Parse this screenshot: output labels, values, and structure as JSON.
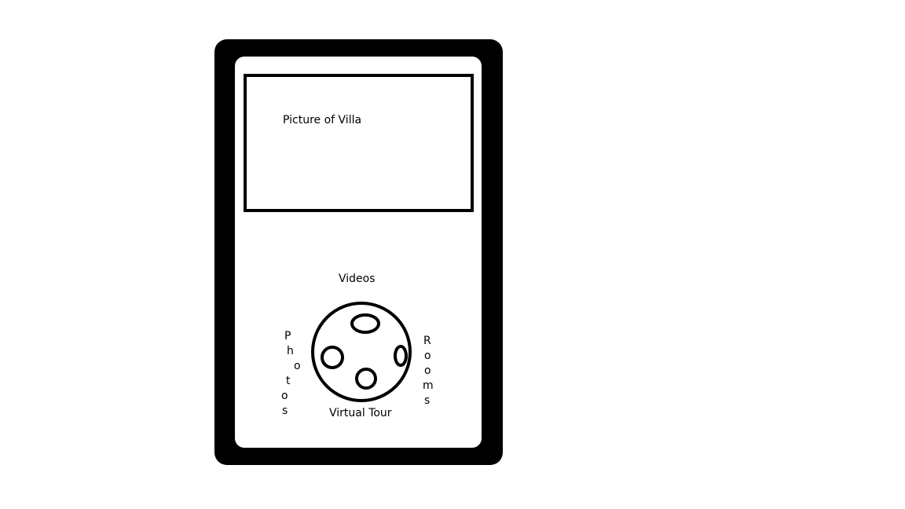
{
  "device": {
    "picture_label": "Picture of Villa",
    "menu": {
      "top_label": "Videos",
      "bottom_label": "Virtual Tour",
      "left_label": "Photos",
      "right_label": "Rooms"
    }
  },
  "colors": {
    "device_body": "#000000",
    "screen": "#ffffff",
    "outline": "#000000"
  }
}
